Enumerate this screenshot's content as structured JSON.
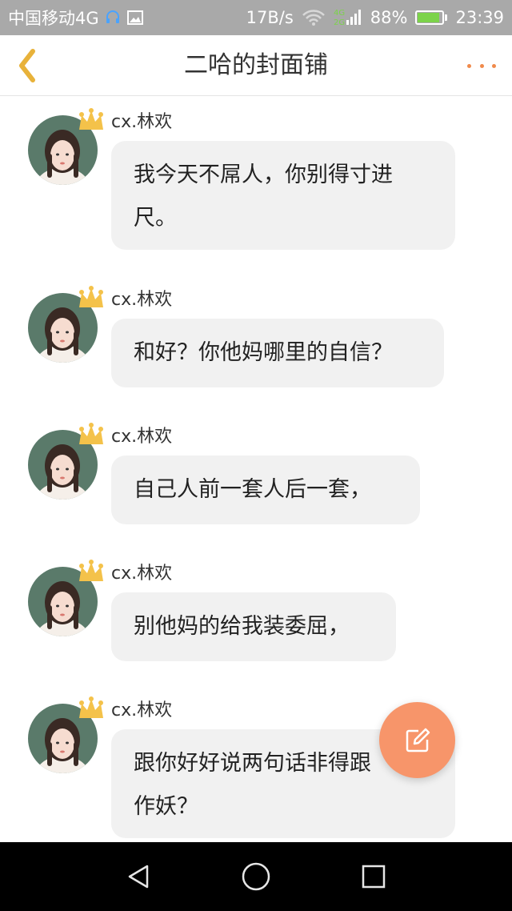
{
  "status_bar": {
    "carrier": "中国移动4G",
    "speed": "17B/s",
    "network_badge_top": "4G",
    "network_badge_bottom": "2G",
    "battery_percent": "88%",
    "battery_level": 0.88,
    "time": "23:39"
  },
  "header": {
    "title": "二哈的封面铺",
    "back_icon": "chevron-left-icon",
    "more_icon": "more-dots-icon"
  },
  "messages": [
    {
      "user": "cx.林欢",
      "text_lines": [
        "我今天不屌人，你别得寸进",
        "尺。"
      ]
    },
    {
      "user": "cx.林欢",
      "text_lines": [
        "和好？你他妈哪里的自信？"
      ]
    },
    {
      "user": "cx.林欢",
      "text_lines": [
        "自己人前一套人后一套，"
      ]
    },
    {
      "user": "cx.林欢",
      "text_lines": [
        "别他妈的给我装委屈，"
      ]
    },
    {
      "user": "cx.林欢",
      "text_lines": [
        "跟你好好说两句话非得跟",
        "作妖？"
      ]
    }
  ],
  "fab": {
    "icon": "edit-icon"
  },
  "system_nav": {
    "back_icon": "triangle-back-icon",
    "home_icon": "circle-home-icon",
    "recents_icon": "square-recents-icon"
  },
  "colors": {
    "accent": "#f7956a",
    "back_arrow": "#e8b23a",
    "bubble": "#f1f1f1",
    "status_bar": "#a9a9a9"
  }
}
